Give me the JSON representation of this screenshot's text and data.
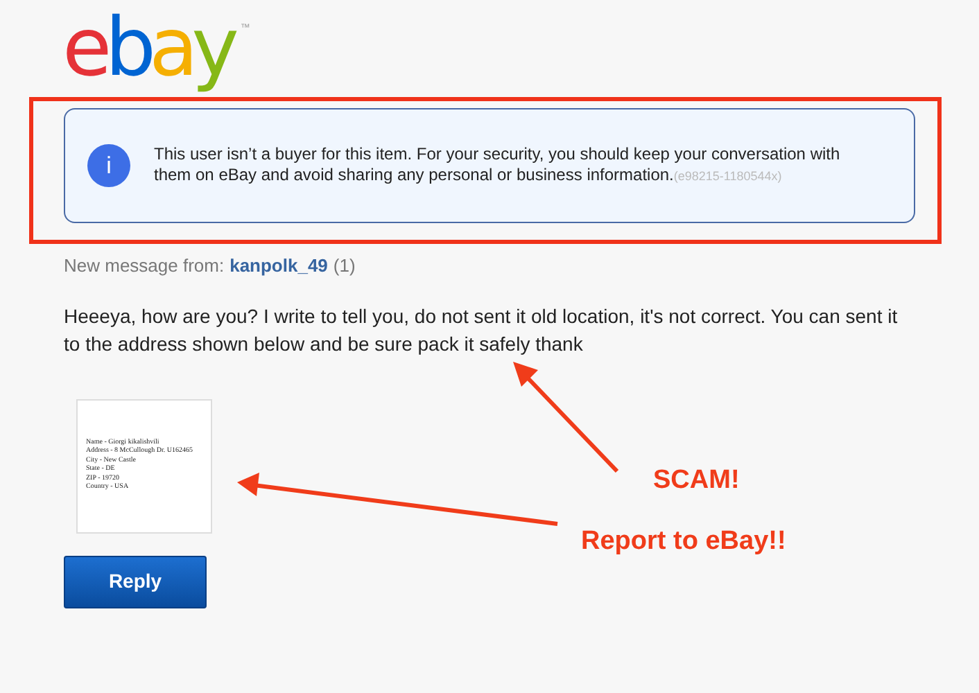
{
  "logo": {
    "letters": [
      {
        "text": "e",
        "color": "#e53238"
      },
      {
        "text": "b",
        "color": "#0064d2"
      },
      {
        "text": "a",
        "color": "#f5af02"
      },
      {
        "text": "y",
        "color": "#86b817"
      }
    ],
    "mark": "™"
  },
  "notice": {
    "icon": "i",
    "text": "This user isn’t a buyer for this item. For your security, you should keep your conversation with them on eBay and avoid sharing any personal or business information.",
    "code": "(e98215-1180544x)"
  },
  "message": {
    "from_label": "New message from:",
    "sender": "kanpolk_49",
    "count": "(1)",
    "body": "Heeeya, how are you? I write to tell you, do not sent it old location, it's not correct. You can sent it to the address shown below and be sure pack it safely thank"
  },
  "attachment": {
    "lines": [
      "Name - Giorgi kikalishvili",
      "Address - 8 McCullough Dr. U162465",
      "City - New Castle",
      "State - DE",
      "ZIP - 19720",
      "Country - USA"
    ]
  },
  "reply_button": "Reply",
  "annotations": [
    {
      "text": "SCAM!"
    },
    {
      "text": "Report to eBay!!"
    }
  ]
}
